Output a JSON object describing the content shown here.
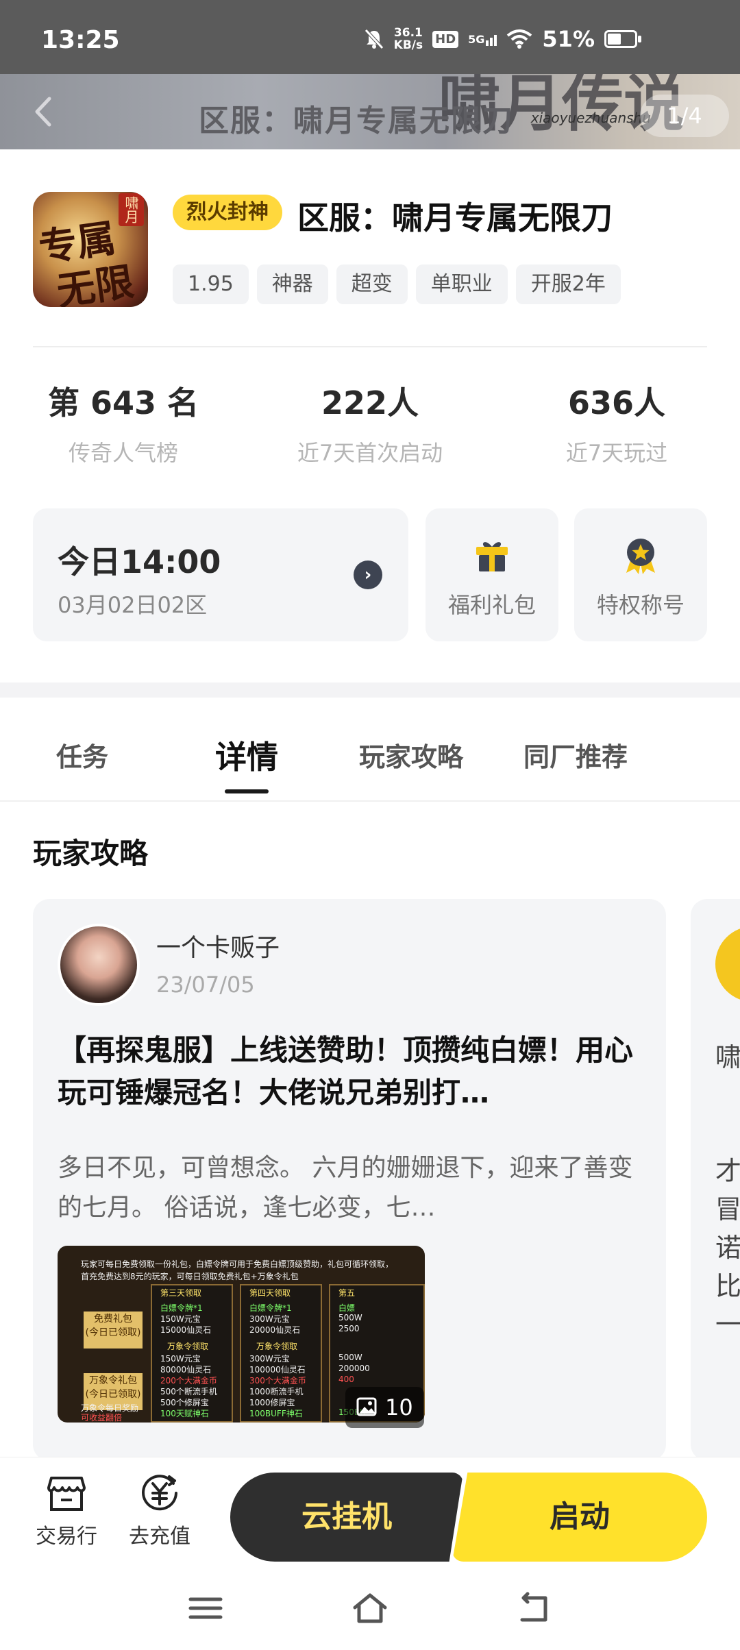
{
  "status_bar": {
    "time": "13:25",
    "net_speed_value": "36.1",
    "net_speed_unit": "KB/s",
    "hd": "HD",
    "network": "5G",
    "battery": "51%",
    "battery_level": 0.51
  },
  "banner": {
    "title": "区服：啸月专属无限刀",
    "counter": "1/4",
    "art_text": "啸月传说",
    "art_sub": "xiaoyuezhuanshu"
  },
  "game": {
    "icon_text_1": "专属",
    "icon_text_2": "无限刀",
    "icon_tag": "啸月",
    "badge": "烈火封神",
    "title": "区服：啸月专属无限刀",
    "tags": [
      "1.95",
      "神器",
      "超变",
      "单职业",
      "开服2年"
    ]
  },
  "stats": [
    {
      "value": "第 643 名",
      "label": "传奇人气榜"
    },
    {
      "value": "222人",
      "label": "近7天首次启动"
    },
    {
      "value": "636人",
      "label": "近7天玩过"
    }
  ],
  "schedule": {
    "time": "今日14:00",
    "server": "03月02日02区"
  },
  "actions": {
    "gift": "福利礼包",
    "title": "特权称号"
  },
  "tabs": [
    "任务",
    "详情",
    "玩家攻略",
    "同厂推荐"
  ],
  "section_title": "玩家攻略",
  "article": {
    "author": "一个卡贩子",
    "date": "23/07/05",
    "headline": "【再探鬼服】上线送赞助！顶攒纯白嫖！用心玩可锤爆冠名！大佬说兄弟别打…",
    "excerpt": "多日不见，可曾想念。 六月的姗姗退下，迎来了善变的七月。 俗话说，逢七必变，七…",
    "image_count": "10",
    "thumb": {
      "header_1": "玩家可每日免费领取一份礼包，白嫖令牌可用于免费白嫖顶级赞助，礼包可循环领取，",
      "header_2": "首充免费达到8元的玩家，可每日领取免费礼包+万象令礼包",
      "side_1": "免费礼包",
      "side_1b": "(今日已领取)",
      "side_2": "万象令礼包",
      "side_2b": "(今日已领取)",
      "foot_1": "万象令每日奖励",
      "foot_2": "可收益翻倍",
      "col_1": "第三天领取",
      "col_2": "第四天领取",
      "col_3": "第五",
      "rows_1": [
        "白嫖令牌*1",
        "150W元宝",
        "15000仙灵石"
      ],
      "rows_2": [
        "白嫖令牌*1",
        "300W元宝",
        "20000仙灵石"
      ],
      "rows_3": [
        "白嫖",
        "500W",
        "2500"
      ],
      "sub": "万象令领取",
      "rows_4": [
        "150W元宝",
        "80000仙灵石",
        "200个大满金币",
        "500个断流手机",
        "500个修屏宝",
        "100天赋神石"
      ],
      "rows_5": [
        "300W元宝",
        "100000仙灵石",
        "300个大满金币",
        "1000断流手机",
        "1000修屏宝",
        "100BUFF神石"
      ],
      "rows_6": [
        "500W",
        "200000",
        "400",
        "",
        "",
        "150BU"
      ]
    }
  },
  "next_card": {
    "chars": [
      "啸",
      "才",
      "冒",
      "诺",
      "比",
      "一"
    ]
  },
  "bottom_bar": {
    "trade": "交易行",
    "recharge": "去充值",
    "cloud": "云挂机",
    "start": "启动"
  },
  "colors": {
    "accent_yellow": "#ffe12b",
    "badge_yellow": "#ffd83d",
    "dark_button": "#2f2f2f"
  }
}
